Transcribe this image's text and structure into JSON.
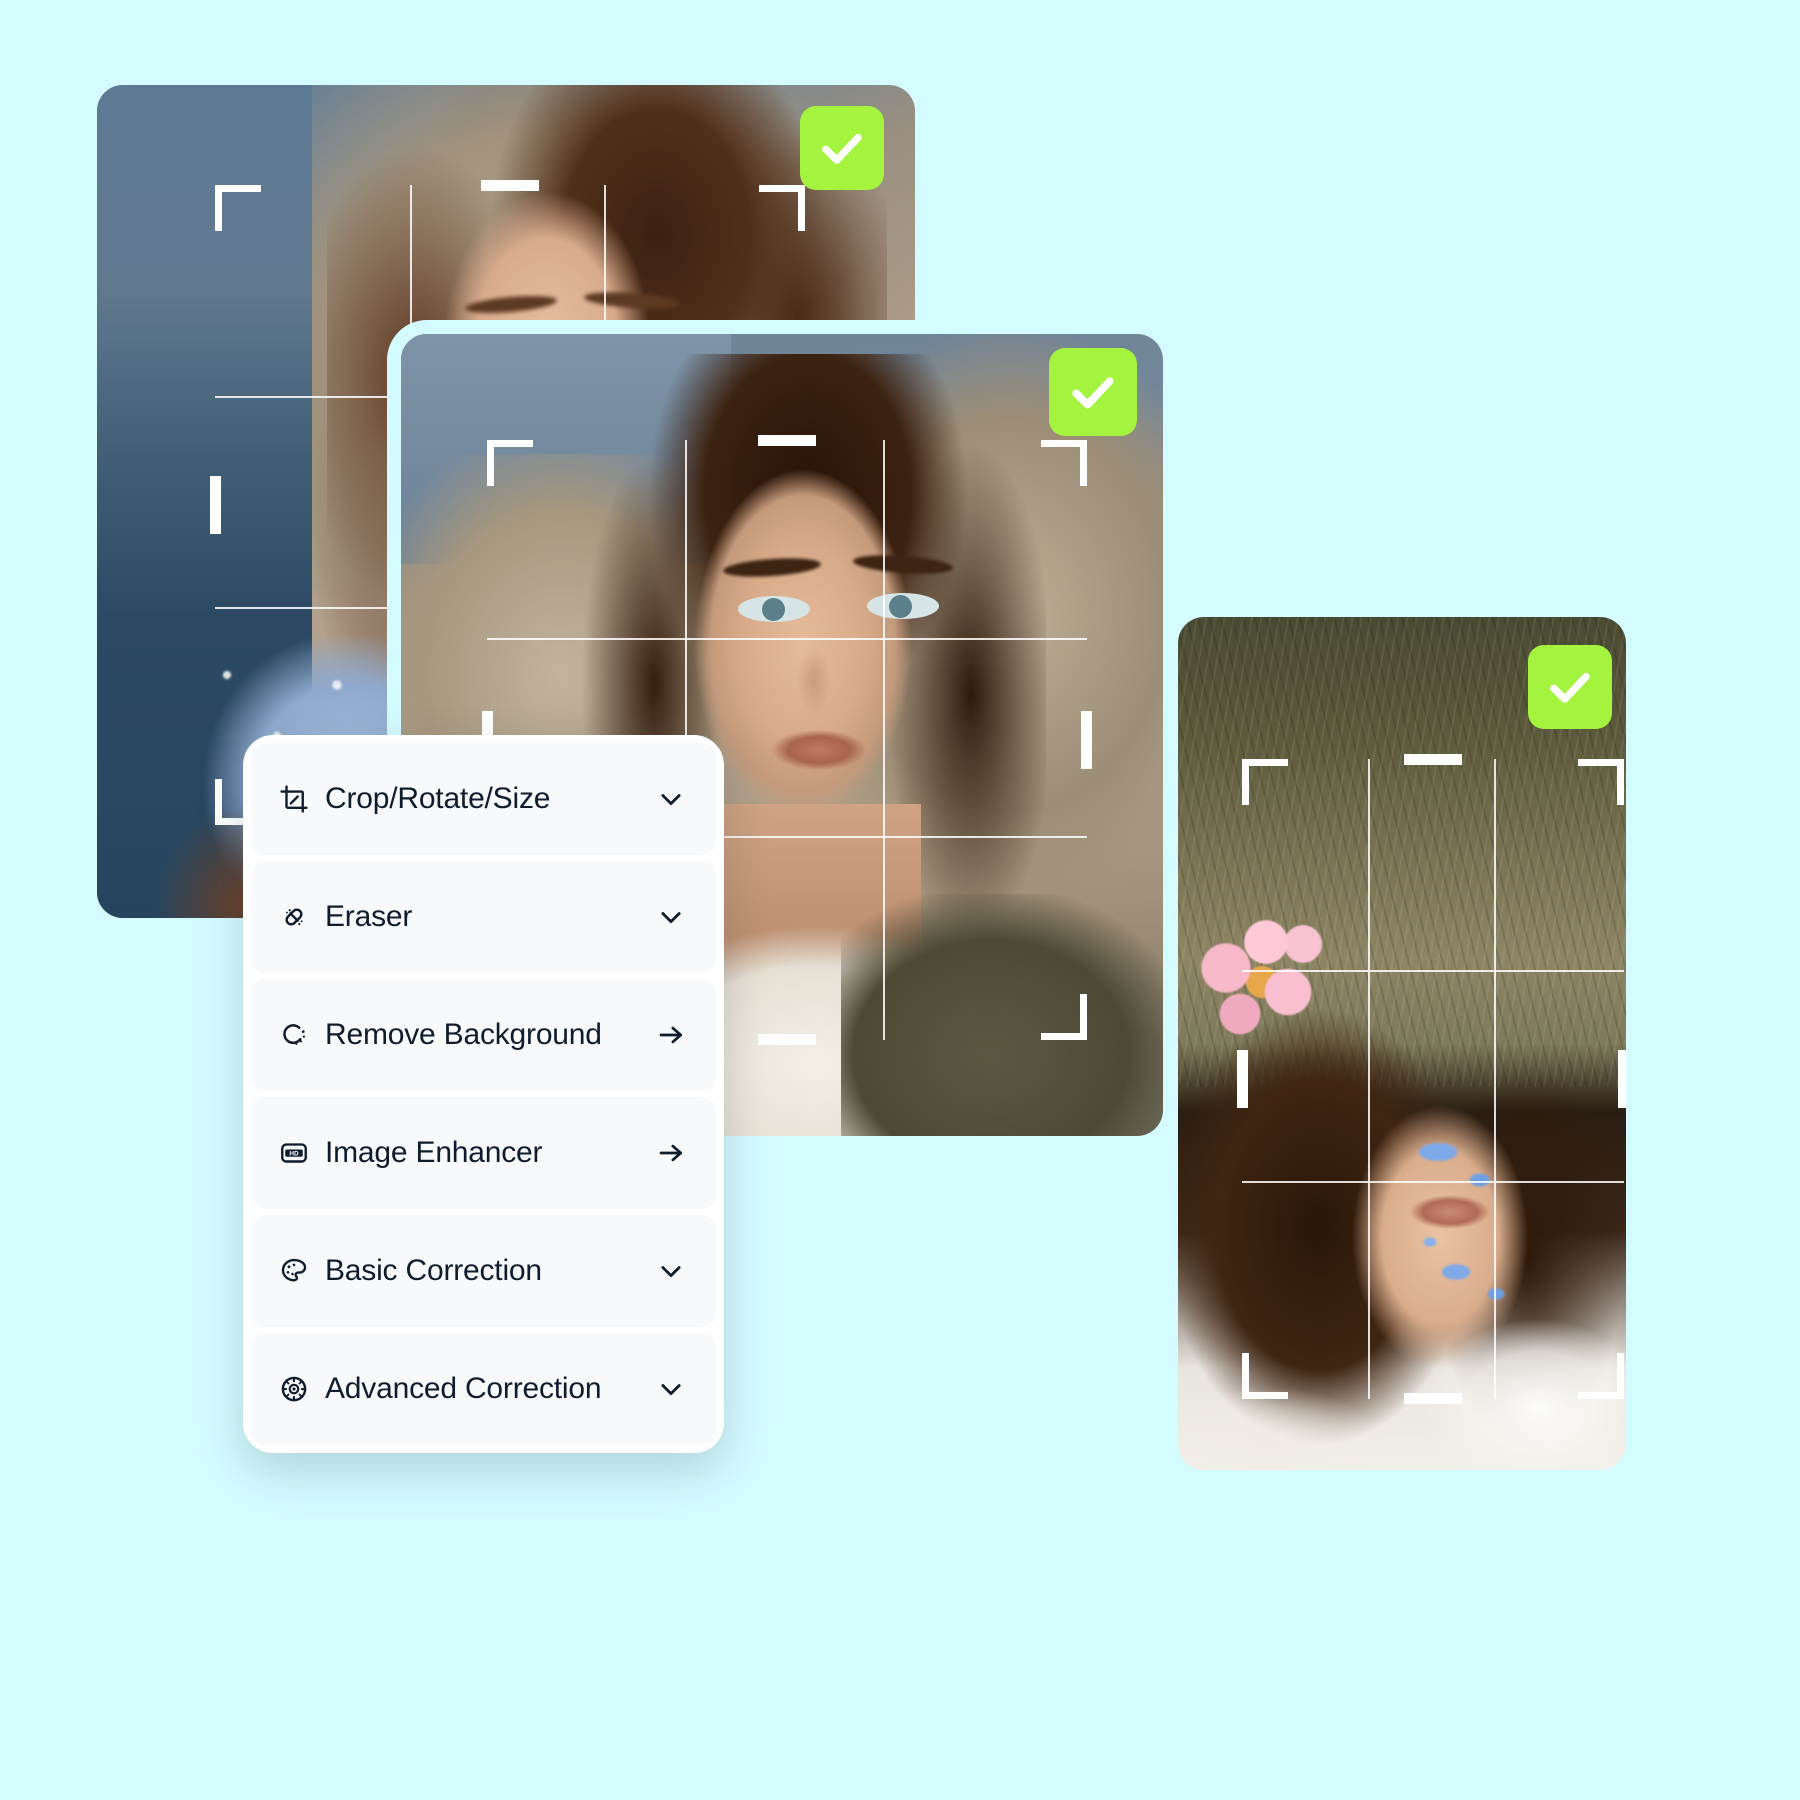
{
  "theme": {
    "background_color": "#D4FBFF",
    "badge_green": "#A3F33F",
    "panel_background": "#FFFFFF",
    "menu_row_background": "#F7F9FB",
    "menu_text_color": "#0F1C2E",
    "crop_overlay_color": "#FFFFFF"
  },
  "photo_cards": [
    {
      "name": "portrait-back-left",
      "alt": "Woman with long brown hair in blue lace dress by the sea",
      "status_badge": "checkmark-icon",
      "crop_overlay": true
    },
    {
      "name": "portrait-center",
      "alt": "Woman in olive blazer and white top against rock background",
      "status_badge": "checkmark-icon",
      "crop_overlay": true
    },
    {
      "name": "portrait-right",
      "alt": "Woman with pink flower in hair lying on grass",
      "status_badge": "checkmark-icon",
      "crop_overlay": true
    }
  ],
  "tool_menu": {
    "items": [
      {
        "id": "crop-rotate-size",
        "label": "Crop/Rotate/Size",
        "icon": "crop-icon",
        "affordance": "chevron-down-icon"
      },
      {
        "id": "eraser",
        "label": "Eraser",
        "icon": "eraser-icon",
        "affordance": "chevron-down-icon"
      },
      {
        "id": "remove-background",
        "label": "Remove Background",
        "icon": "remove-background-icon",
        "affordance": "arrow-right-icon"
      },
      {
        "id": "image-enhancer",
        "label": "Image Enhancer",
        "icon": "hd-icon",
        "affordance": "arrow-right-icon"
      },
      {
        "id": "basic-correction",
        "label": "Basic Correction",
        "icon": "palette-icon",
        "affordance": "chevron-down-icon"
      },
      {
        "id": "advanced-correction",
        "label": "Advanced Correction",
        "icon": "color-wheel-icon",
        "affordance": "chevron-down-icon"
      }
    ]
  }
}
